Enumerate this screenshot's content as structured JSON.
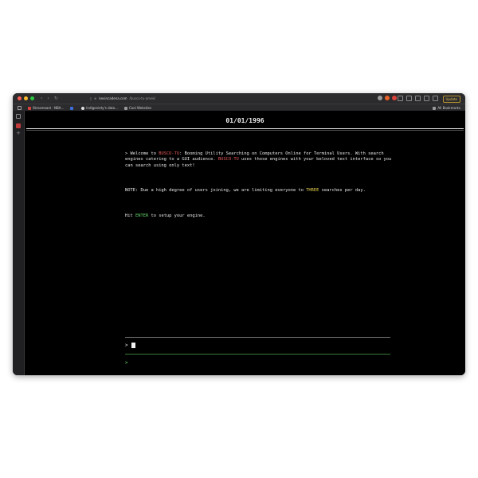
{
  "browser": {
    "url_host": "kevincadena.com",
    "url_path": "/busco-tu-amek/",
    "update_label": "Update",
    "bookmarks": [
      {
        "label": "Streameast - NBA...",
        "color": "#d9433b"
      },
      {
        "label": "",
        "color": "#3b6fd9"
      },
      {
        "label": "Indigeniety's data...",
        "color": "#e0e0e0"
      },
      {
        "label": "Cool Websites",
        "color": "#9a9a9a"
      }
    ],
    "all_bookmarks_label": "All Bookmarks"
  },
  "page": {
    "date": "01/01/1996",
    "intro_prefix": "> Welcome to ",
    "brand": "BUSCO-TU",
    "intro_mid": ": Booming Utility Searching on Computers Online for Terminal Users. With search engines catering to a GUI audience. ",
    "intro_suffix": " uses those engines with your beloved text interface so you can search using only text!",
    "note_prefix": "NOTE: Due a high degree of users joining, we are limiting everyone to ",
    "note_highlight": "THREE",
    "note_suffix": " searches per day.",
    "hit_prefix": "Hit ",
    "hit_key": "ENTER",
    "hit_suffix": " to setup your engine.",
    "input_prompt": ">",
    "output_prompt": ">"
  },
  "colors": {
    "brand_red": "#e65a5a",
    "highlight_yellow": "#e8d44d",
    "key_green": "#63d46b",
    "background": "#000000"
  }
}
